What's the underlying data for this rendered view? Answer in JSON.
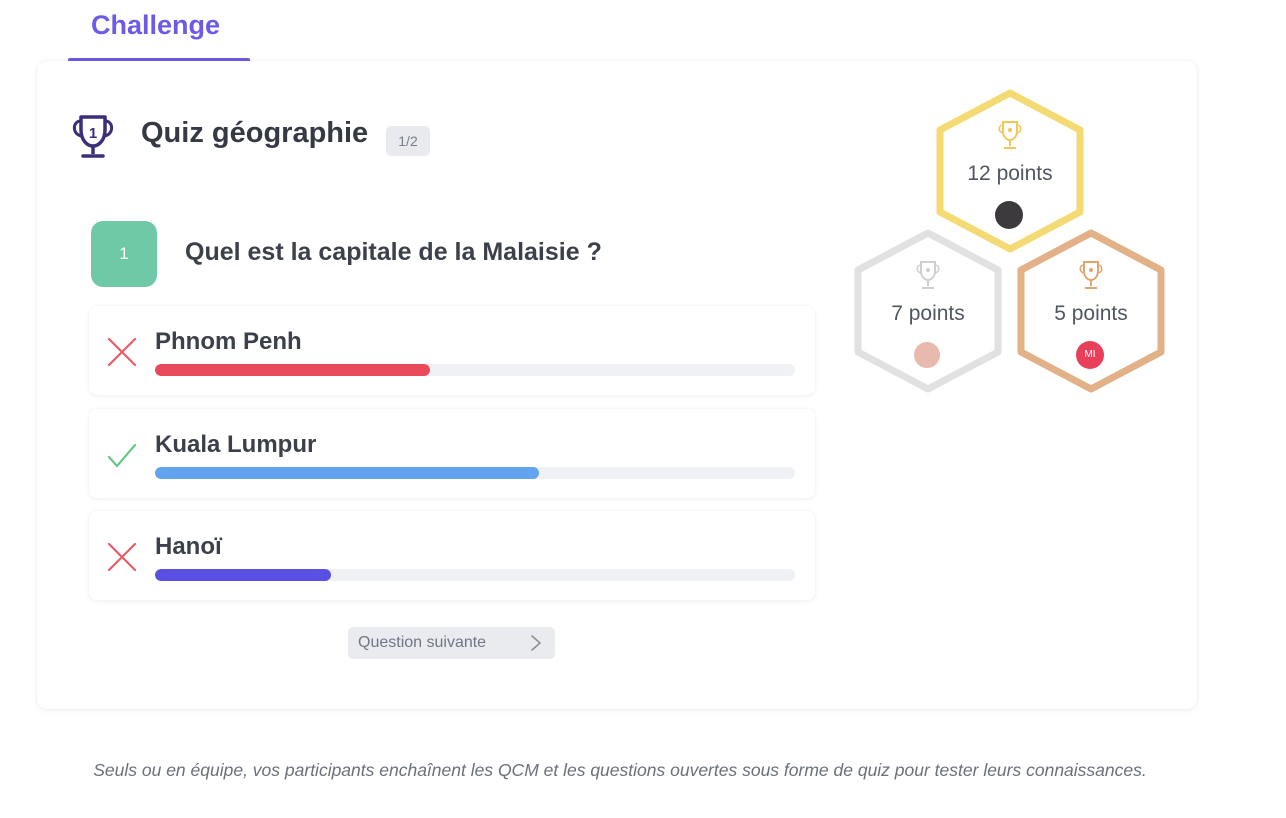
{
  "tab": {
    "label": "Challenge"
  },
  "quiz": {
    "title": "Quiz géographie",
    "badge": "1/2",
    "question_number": "1",
    "question": "Quel est la capitale de la Malaisie ?"
  },
  "answers": [
    {
      "label": "Phnom Penh",
      "correct": false,
      "status_icon": "cross-icon",
      "fill_fraction": 0.43,
      "color": "#e94a5a"
    },
    {
      "label": "Kuala Lumpur",
      "correct": true,
      "status_icon": "check-icon",
      "fill_fraction": 0.6,
      "color": "#62a2ef"
    },
    {
      "label": "Hanoï",
      "correct": false,
      "status_icon": "cross-icon",
      "fill_fraction": 0.275,
      "color": "#5a4fe3"
    }
  ],
  "next_button": {
    "label": "Question suivante"
  },
  "leaderboard": [
    {
      "rank": 1,
      "points": "12 points",
      "color": "#f3da72",
      "avatar_color": "#3c3a3d",
      "avatar_initials": ""
    },
    {
      "rank": 2,
      "points": "7 points",
      "color": "#e1e1e1",
      "avatar_color": "#e8b9ad",
      "avatar_initials": ""
    },
    {
      "rank": 3,
      "points": "5 points",
      "color": "#e2b187",
      "avatar_color": "#e8405a",
      "avatar_initials": "MI"
    }
  ],
  "caption": "Seuls ou en équipe, vos participants enchaînent les QCM et les questions ouvertes sous forme de quiz pour tester leurs connaissances."
}
